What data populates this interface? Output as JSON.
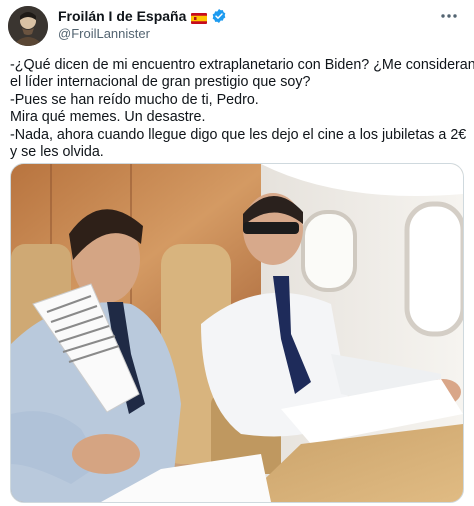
{
  "tweet": {
    "display_name": "Froilán I de España",
    "handle": "@FroilLannister",
    "lines": [
      "-¿Qué dicen de mi encuentro extraplanetario con Biden? ¿Me consideran",
      "el líder internacional de gran prestigio que soy?",
      "-Pues se han reído mucho de ti, Pedro.",
      "Mira qué memes. Un desastre.",
      "-Nada, ahora cuando llegue digo que les dejo el cine a los jubiletas a 2€",
      "y se les olvida."
    ]
  },
  "icons": {
    "flag": "spain-flag-icon",
    "verified": "verified-badge-icon",
    "more": "more-options-icon"
  },
  "colors": {
    "text": "#0f1419",
    "secondary": "#536471",
    "verified": "#1d9bf0",
    "border": "#cfd9de"
  }
}
